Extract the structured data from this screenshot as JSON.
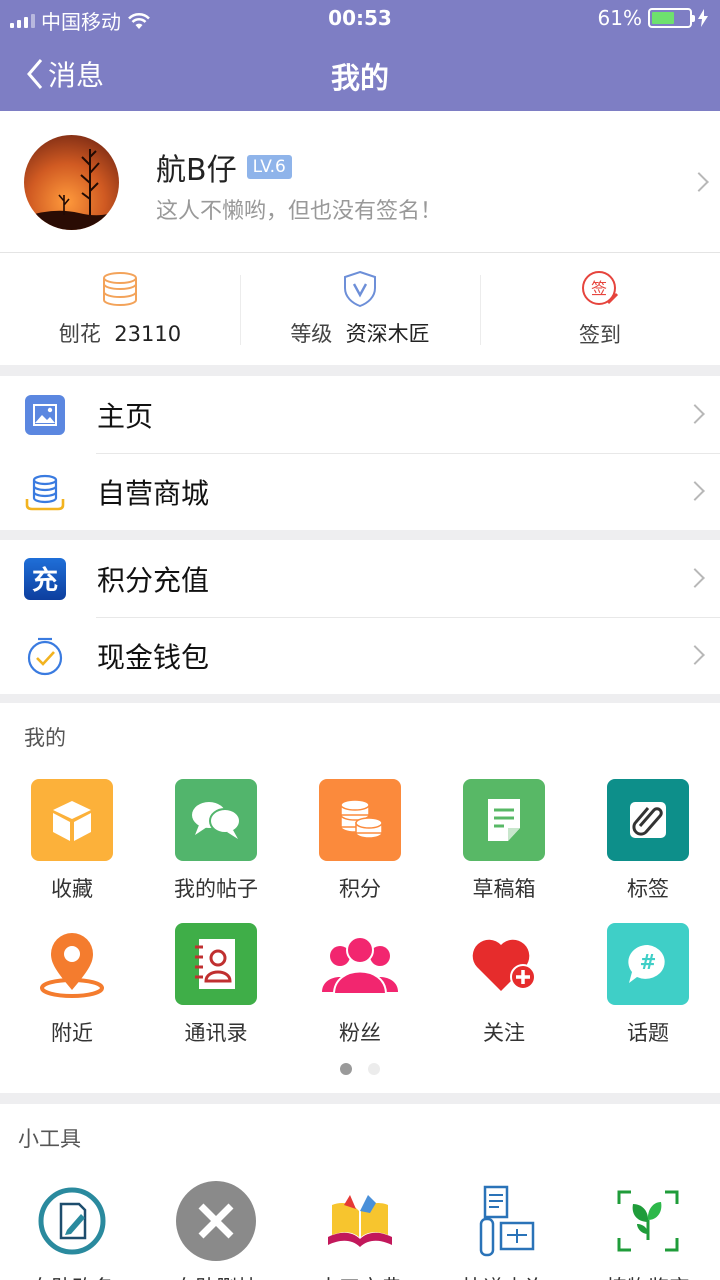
{
  "status_bar": {
    "carrier": "中国移动",
    "time": "00:53",
    "battery": "61%",
    "battery_level": 0.61
  },
  "nav": {
    "back_label": "消息",
    "title": "我的"
  },
  "profile": {
    "name": "航B仔",
    "level": "LV.6",
    "signature": "这人不懒哟，但也没有签名！"
  },
  "stats": [
    {
      "label": "刨花",
      "value": "23110",
      "icon": "coins-stack-icon"
    },
    {
      "label": "等级",
      "value": "资深木匠",
      "icon": "shield-v-icon"
    },
    {
      "label": "签到",
      "value": "",
      "icon": "sign-in-icon"
    }
  ],
  "menu_group_1": [
    {
      "label": "主页",
      "icon": "image-icon"
    },
    {
      "label": "自营商城",
      "icon": "database-icon"
    }
  ],
  "menu_group_2": [
    {
      "label": "积分充值",
      "icon": "recharge-icon",
      "icon_text": "充"
    },
    {
      "label": "现金钱包",
      "icon": "wallet-check-icon"
    }
  ],
  "mine": {
    "title": "我的",
    "items": [
      {
        "label": "收藏",
        "icon": "box-icon",
        "color": "#fcb13a"
      },
      {
        "label": "我的帖子",
        "icon": "chat-bubbles-icon",
        "color": "#52b56c"
      },
      {
        "label": "积分",
        "icon": "coins-icon",
        "color": "#fb8a3c"
      },
      {
        "label": "草稿箱",
        "icon": "draft-icon",
        "color": "#58b866"
      },
      {
        "label": "标签",
        "icon": "paperclip-icon",
        "color": "#0d8f8a"
      },
      {
        "label": "附近",
        "icon": "location-pin-icon",
        "color": "#f47c2e"
      },
      {
        "label": "通讯录",
        "icon": "contacts-book-icon",
        "color": "#3fae48"
      },
      {
        "label": "粉丝",
        "icon": "fans-icon",
        "color": "#f2266f"
      },
      {
        "label": "关注",
        "icon": "heart-plus-icon",
        "color": "#e62c2c"
      },
      {
        "label": "话题",
        "icon": "hashtag-bubble-icon",
        "color": "#3fcfc7"
      }
    ],
    "page": 1,
    "page_count": 2
  },
  "tools": {
    "title": "小工具",
    "items": [
      {
        "label": "自助改名",
        "icon": "edit-doc-icon"
      },
      {
        "label": "自助删帖",
        "icon": "delete-x-icon"
      },
      {
        "label": "木工宝典",
        "icon": "book-icon"
      },
      {
        "label": "快递查询",
        "icon": "delivery-icon"
      },
      {
        "label": "植物鉴定",
        "icon": "plant-scan-icon"
      }
    ]
  }
}
